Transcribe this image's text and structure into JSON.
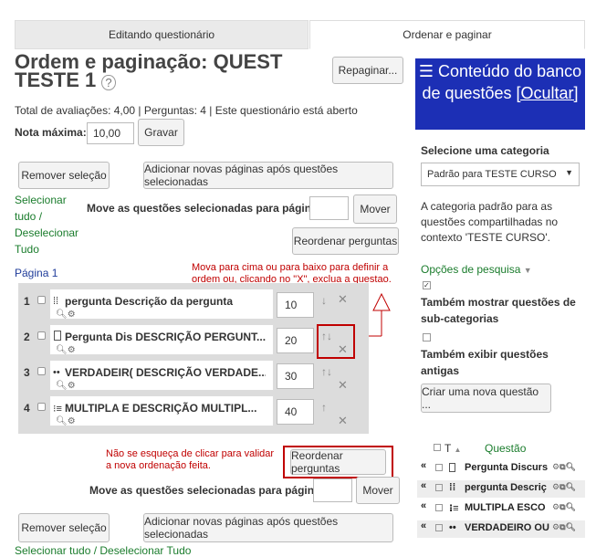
{
  "tabs": [
    {
      "label": "Editando questionário"
    },
    {
      "label": "Ordenar e paginar"
    }
  ],
  "page_title": "Ordem e paginação: QUEST TESTE 1",
  "repaginate_label": "Repaginar...",
  "summary_text": "Total de avaliações: 4,00 | Perguntas: 4 | Este questionário está aberto",
  "max_grade": {
    "label": "Nota máxima:",
    "value": "10,00",
    "save_label": "Gravar"
  },
  "top_controls": {
    "remove_selection": "Remover seleção",
    "add_pages": "Adicionar novas páginas após questões selecionadas",
    "select_all": "Selecionar tudo",
    "separator": "/",
    "deselect_all": "Deselecionar Tudo",
    "move_label": "Move as questões selecionadas para página:",
    "move_button": "Mover",
    "reorder_button": "Reordenar perguntas"
  },
  "page_label": "Página 1",
  "annotation_top": "Mova para cima ou para baixo para definir a ordem ou, clicando no \"X\", exclua a questao.",
  "questions": [
    {
      "number": "1",
      "icon": "ordering-icon",
      "text": "pergunta Descrição da pergunta",
      "order": "10"
    },
    {
      "number": "2",
      "icon": "essay-icon",
      "text": "Pergunta Dis DESCRIÇÃO PERGUNT...",
      "order": "20"
    },
    {
      "number": "3",
      "icon": "dots-icon",
      "text": "VERDADEIR( DESCRIÇÃO VERDADE...",
      "order": "30"
    },
    {
      "number": "4",
      "icon": "multichoice-icon",
      "text": "MULTIPLA E DESCRIÇÃO MULTIPL...",
      "order": "40"
    }
  ],
  "annotation_bottom": "Não se esqueça de clicar para validar a nova ordenação feita.",
  "bottom_controls": {
    "reorder_button": "Reordenar perguntas",
    "move_label": "Move as questões selecionadas para página:",
    "move_button": "Mover",
    "remove_selection": "Remover seleção",
    "add_pages": "Adicionar novas páginas após questões selecionadas",
    "select_all_text": "Selecionar tudo / Deselecionar Tudo"
  },
  "sidebar": {
    "header_title": "Conteúdo do banco de questões",
    "hide_link": "[Ocultar]",
    "category_label": "Selecione uma categoria",
    "category_value": "Padrão para TESTE CURSO",
    "category_description": "A categoria padrão para as questões compartilhadas no contexto 'TESTE CURSO'.",
    "search_options": "Opções de pesquisa",
    "show_subcategories": "Também mostrar questões de sub-categorias",
    "show_old": "Também exibir questões antigas",
    "create_question": "Criar uma nova questão ...",
    "col_type": "T",
    "col_question": "Questão",
    "bank_items": [
      {
        "text": "Pergunta Discurs"
      },
      {
        "text": "pergunta Descriç"
      },
      {
        "text": "MULTIPLA ESCO"
      },
      {
        "text": "VERDADEIRO OU"
      }
    ]
  },
  "colors": {
    "accent": "#1c2fb5",
    "link": "#1a7c2c",
    "annotation": "#c00000"
  }
}
